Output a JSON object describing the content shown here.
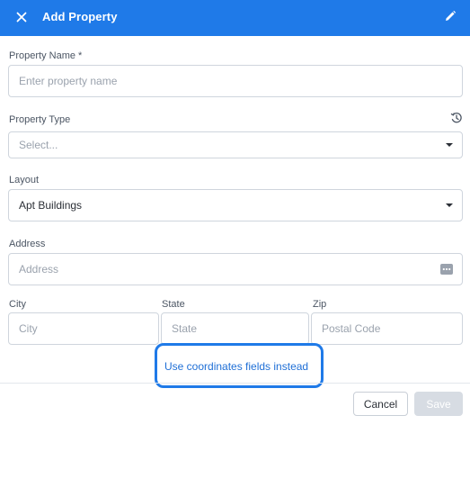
{
  "header": {
    "title": "Add Property",
    "close_icon": "close-icon",
    "edit_icon": "pencil-icon",
    "background_color": "#1f7ae8"
  },
  "form": {
    "property_name": {
      "label": "Property Name *",
      "placeholder": "Enter property name",
      "value": ""
    },
    "property_type": {
      "label": "Property Type",
      "selected": "Select...",
      "icon": "history-icon"
    },
    "layout": {
      "label": "Layout",
      "selected": "Apt Buildings"
    },
    "address": {
      "label": "Address",
      "placeholder": "Address",
      "icon": "more-dots-icon"
    },
    "city": {
      "label": "City",
      "placeholder": "City"
    },
    "state": {
      "label": "State",
      "placeholder": "State"
    },
    "zip": {
      "label": "Zip",
      "placeholder": "Postal Code"
    },
    "coordinates_link": "Use coordinates fields instead"
  },
  "footer": {
    "cancel_label": "Cancel",
    "save_label": "Save",
    "save_enabled": false
  }
}
